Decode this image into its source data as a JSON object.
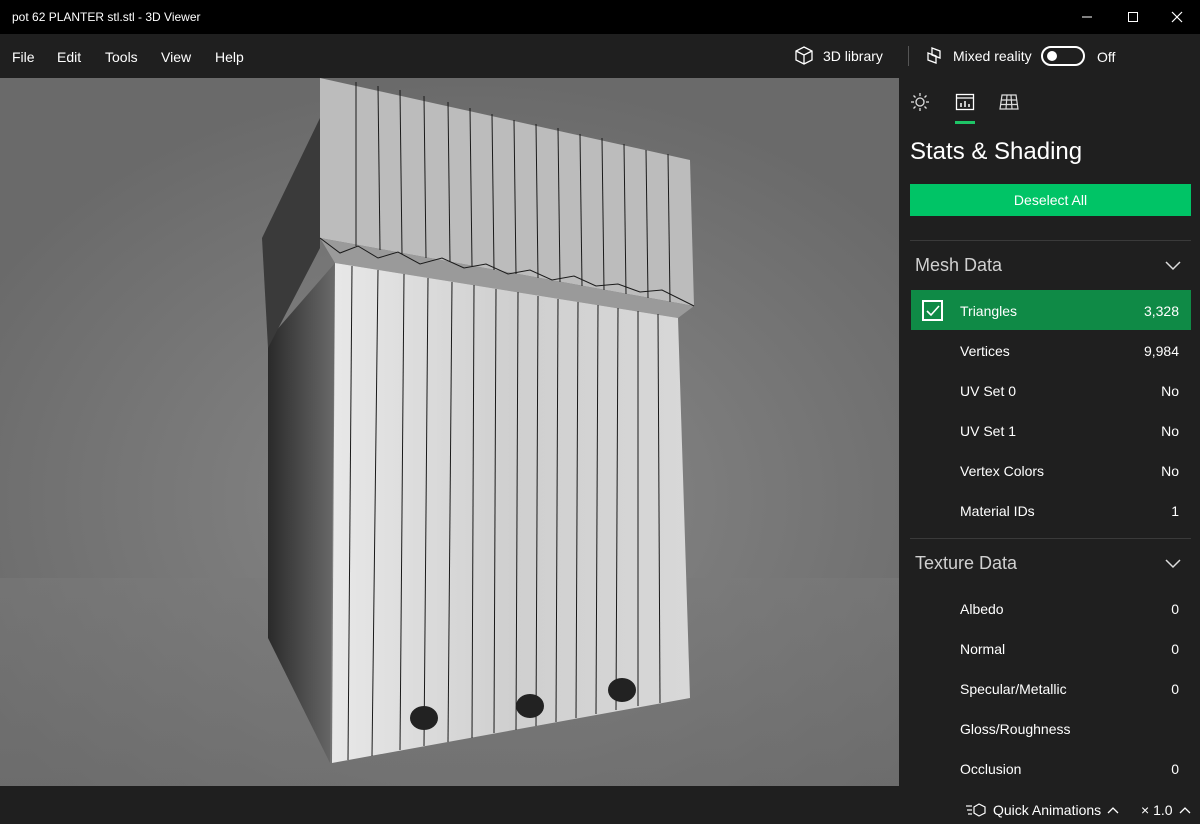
{
  "window": {
    "title": "pot 62 PLANTER stl.stl - 3D Viewer"
  },
  "menu": {
    "items": [
      "File",
      "Edit",
      "Tools",
      "View",
      "Help"
    ]
  },
  "toolbar": {
    "library_label": "3D library",
    "mixed_reality_label": "Mixed reality",
    "toggle_state": "Off"
  },
  "panel": {
    "tabs": [
      "sun-icon",
      "stats-icon",
      "grid-icon"
    ],
    "title": "Stats & Shading",
    "deselect_label": "Deselect All",
    "mesh_section": "Mesh Data",
    "mesh_rows": [
      {
        "label": "Triangles",
        "value": "3,328"
      },
      {
        "label": "Vertices",
        "value": "9,984"
      },
      {
        "label": "UV Set 0",
        "value": "No"
      },
      {
        "label": "UV Set 1",
        "value": "No"
      },
      {
        "label": "Vertex Colors",
        "value": "No"
      },
      {
        "label": "Material IDs",
        "value": "1"
      }
    ],
    "texture_section": "Texture Data",
    "texture_rows": [
      {
        "label": "Albedo",
        "value": "0"
      },
      {
        "label": "Normal",
        "value": "0"
      },
      {
        "label": "Specular/Metallic",
        "value": "0"
      },
      {
        "label": "Gloss/Roughness",
        "value": ""
      },
      {
        "label": "Occlusion",
        "value": "0"
      }
    ]
  },
  "status": {
    "animations_label": "Quick Animations",
    "speed": "× 1.0"
  },
  "colors": {
    "accent": "#00c466",
    "selected_row": "#0f8a46"
  }
}
